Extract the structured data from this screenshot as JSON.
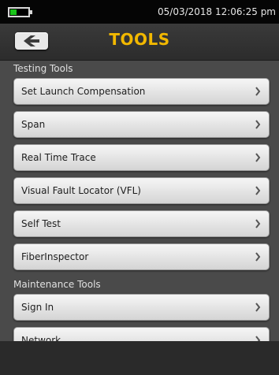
{
  "status": {
    "datetime": "05/03/2018 12:06:25 pm",
    "battery_color": "#19c419"
  },
  "header": {
    "title": "TOOLS",
    "back_icon": "back-arrow-icon",
    "title_color": "#f2b800"
  },
  "sections": [
    {
      "title": "Testing Tools",
      "items": [
        {
          "label": "Set Launch Compensation"
        },
        {
          "label": "Span"
        },
        {
          "label": "Real Time Trace"
        },
        {
          "label": "Visual Fault Locator (VFL)"
        },
        {
          "label": "Self Test"
        },
        {
          "label": "FiberInspector"
        }
      ]
    },
    {
      "title": "Maintenance Tools",
      "items": [
        {
          "label": "Sign In"
        },
        {
          "label": "Network"
        }
      ]
    }
  ]
}
